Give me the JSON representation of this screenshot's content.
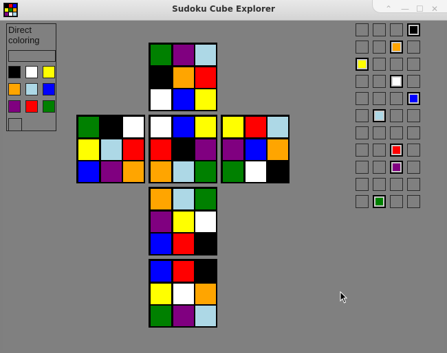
{
  "window": {
    "title": "Sudoku Cube Explorer",
    "controls": [
      "⌃",
      "—",
      "☐",
      "✕"
    ]
  },
  "colors": {
    "K": "#000000",
    "W": "#ffffff",
    "Y": "#ffff00",
    "O": "#ffa500",
    "L": "#add8e6",
    "B": "#0000ff",
    "P": "#800080",
    "R": "#ff0000",
    "G": "#008000",
    "background": "#808080"
  },
  "app_icon_cells": [
    "K",
    "R",
    "B",
    "Y",
    "G",
    "O",
    "P",
    "W",
    "L"
  ],
  "panel": {
    "label": "Direct\ncoloring",
    "palette": [
      "K",
      "W",
      "Y",
      "O",
      "L",
      "B",
      "P",
      "R",
      "G"
    ]
  },
  "faces": [
    {
      "name": "top",
      "cells": [
        "G",
        "P",
        "L",
        "K",
        "O",
        "R",
        "W",
        "B",
        "Y"
      ]
    },
    {
      "name": "left",
      "cells": [
        "G",
        "K",
        "W",
        "Y",
        "L",
        "R",
        "B",
        "P",
        "O"
      ]
    },
    {
      "name": "front",
      "cells": [
        "W",
        "B",
        "Y",
        "R",
        "K",
        "P",
        "O",
        "L",
        "G"
      ]
    },
    {
      "name": "right",
      "cells": [
        "Y",
        "R",
        "L",
        "P",
        "B",
        "O",
        "G",
        "W",
        "K"
      ]
    },
    {
      "name": "bottom",
      "cells": [
        "O",
        "L",
        "G",
        "P",
        "Y",
        "W",
        "B",
        "R",
        "K"
      ]
    },
    {
      "name": "back",
      "cells": [
        "B",
        "R",
        "K",
        "Y",
        "W",
        "O",
        "G",
        "P",
        "L"
      ]
    }
  ],
  "assignment_grid": {
    "rows": [
      [
        "",
        "",
        "",
        "K"
      ],
      [
        "",
        "",
        "O",
        ""
      ],
      [
        "Y",
        "",
        "",
        ""
      ],
      [
        "",
        "",
        "W",
        ""
      ],
      [
        "",
        "",
        "",
        "B"
      ],
      [
        "",
        "L",
        "",
        ""
      ],
      [
        "",
        "",
        "",
        ""
      ],
      [
        "",
        "",
        "R",
        ""
      ],
      [
        "",
        "",
        "P",
        ""
      ],
      [
        "",
        "",
        "",
        ""
      ],
      [
        "",
        "G",
        "",
        ""
      ]
    ]
  }
}
